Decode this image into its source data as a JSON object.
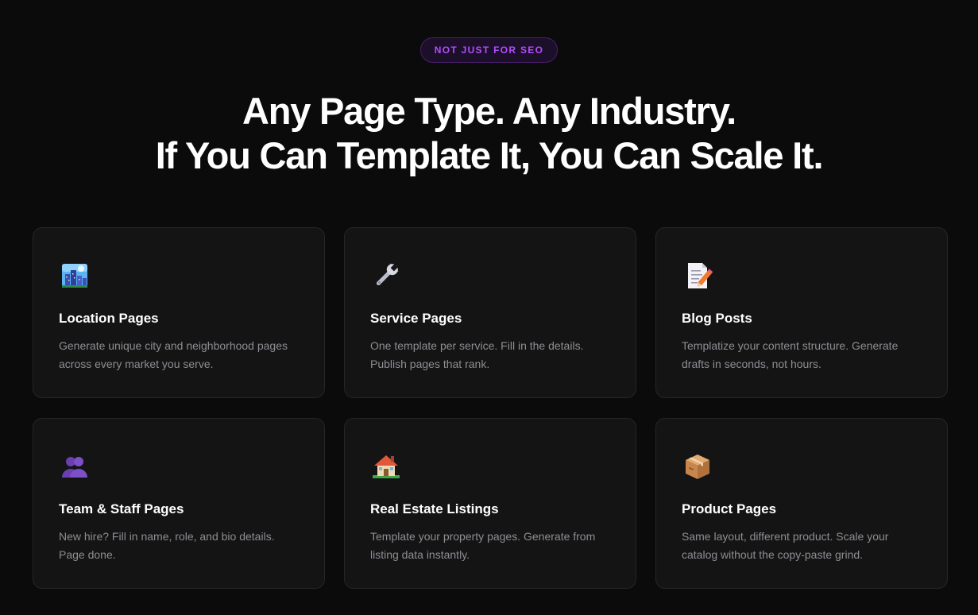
{
  "badge": {
    "label": "NOT JUST FOR SEO"
  },
  "headline": {
    "line1": "Any Page Type. Any Industry.",
    "line2": "If You Can Template It, You Can Scale It."
  },
  "cards": [
    {
      "icon": "cityscape-icon",
      "title": "Location Pages",
      "description": "Generate unique city and neighborhood pages across every market you serve."
    },
    {
      "icon": "wrench-icon",
      "title": "Service Pages",
      "description": "One template per service. Fill in the details. Publish pages that rank."
    },
    {
      "icon": "memo-icon",
      "title": "Blog Posts",
      "description": "Templatize your content structure. Generate drafts in seconds, not hours."
    },
    {
      "icon": "people-icon",
      "title": "Team & Staff Pages",
      "description": "New hire? Fill in name, role, and bio details. Page done."
    },
    {
      "icon": "house-icon",
      "title": "Real Estate Listings",
      "description": "Template your property pages. Generate from listing data instantly."
    },
    {
      "icon": "package-icon",
      "title": "Product Pages",
      "description": "Same layout, different product. Scale your catalog without the copy-paste grind."
    }
  ],
  "colors": {
    "background": "#0b0b0c",
    "card": "#141415",
    "accent": "#b54cff"
  }
}
